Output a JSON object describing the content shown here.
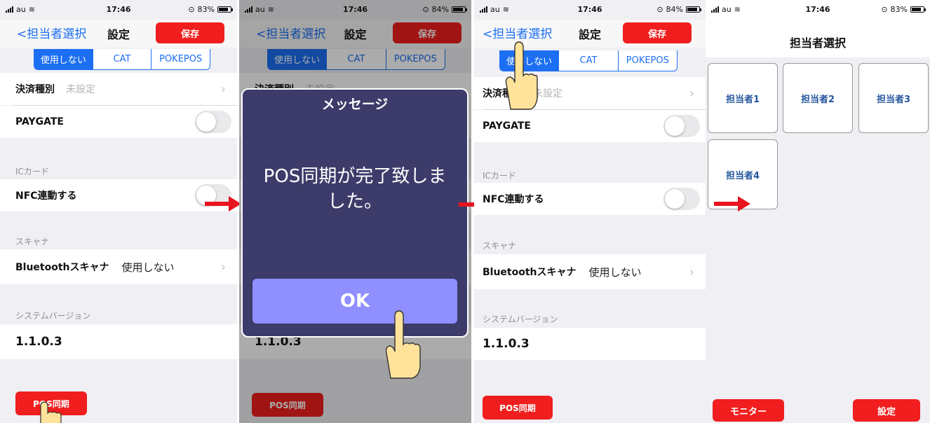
{
  "status_bars": [
    {
      "carrier": "au",
      "time": "17:46",
      "battery": "83%",
      "battery_level": 0.83
    },
    {
      "carrier": "au",
      "time": "17:46",
      "battery": "84%",
      "battery_level": 0.84
    },
    {
      "carrier": "au",
      "time": "17:46",
      "battery": "84%",
      "battery_level": 0.84
    },
    {
      "carrier": "au",
      "time": "17:46",
      "battery": "83%",
      "battery_level": 0.83
    }
  ],
  "settings": {
    "back_label": "<担当者選択",
    "title": "設定",
    "save_label": "保存",
    "segments": [
      "使用しない",
      "CAT",
      "POKEPOS"
    ],
    "payment_type_label": "決済種別",
    "payment_type_value": "未設定",
    "paygate_label": "PAYGATE",
    "ic_section": "ICカード",
    "nfc_label": "NFC連動する",
    "scanner_section": "スキャナ",
    "bluetooth_label": "Bluetoothスキャナ",
    "bluetooth_value": "使用しない",
    "version_section": "システムバージョン",
    "version_value": "1.1.0.3",
    "pos_sync_label": "POS同期"
  },
  "dialog": {
    "title": "メッセージ",
    "message_line1": "POS同期が完了致しま",
    "message_line2": "した。",
    "ok_label": "OK"
  },
  "staff_select": {
    "title": "担当者選択",
    "staff": [
      "担当者1",
      "担当者2",
      "担当者3",
      "担当者4"
    ],
    "monitor_label": "モニター",
    "settings_label": "設定"
  },
  "colors": {
    "accent_blue": "#1c6ff2",
    "red": "#f01e1e",
    "arrow_red": "#e8141e",
    "dialog_bg": "#3c3b6a",
    "ok_button": "#8f8fff"
  },
  "icons": {
    "arrow": "right-arrow-icon",
    "hand": "pointing-hand-icon",
    "chevron": "chevron-right-icon"
  }
}
